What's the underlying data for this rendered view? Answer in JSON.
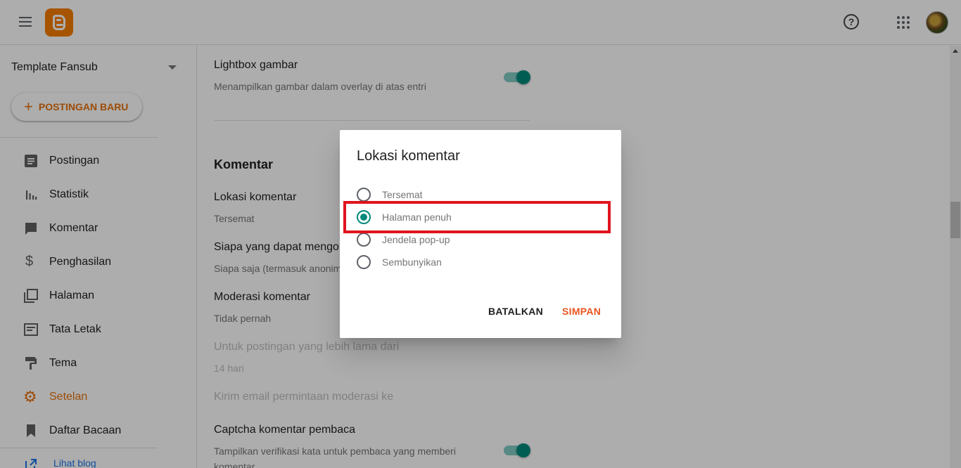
{
  "colors": {
    "accent": "#e8710a",
    "teal": "#00897b",
    "highlight": "#e0141e"
  },
  "header": {
    "menu_icon": "menu-icon",
    "logo": "blogger-logo",
    "help_icon": "help-icon",
    "help_glyph": "?",
    "apps_icon": "apps-grid-icon",
    "avatar": "user-avatar"
  },
  "sidebar": {
    "blog_name": "Template Fansub",
    "new_post_plus": "+",
    "new_post_label": "POSTINGAN BARU",
    "items": [
      {
        "label": "Postingan",
        "icon": "posts-icon"
      },
      {
        "label": "Statistik",
        "icon": "stats-icon"
      },
      {
        "label": "Komentar",
        "icon": "comment-icon"
      },
      {
        "label": "Penghasilan",
        "icon": "dollar-icon",
        "glyph": "$"
      },
      {
        "label": "Halaman",
        "icon": "pages-icon"
      },
      {
        "label": "Tata Letak",
        "icon": "layout-icon"
      },
      {
        "label": "Tema",
        "icon": "theme-icon"
      },
      {
        "label": "Setelan",
        "icon": "gear-icon",
        "glyph": "⚙"
      },
      {
        "label": "Daftar Bacaan",
        "icon": "bookmark-icon"
      }
    ],
    "view_blog": "Lihat blog"
  },
  "main": {
    "lightbox_title": "Lightbox gambar",
    "lightbox_sub": "Menampilkan gambar dalam overlay di atas entri",
    "section_comments": "Komentar",
    "location_title": "Lokasi komentar",
    "location_value": "Tersemat",
    "who_title": "Siapa yang dapat mengom",
    "who_value": "Siapa saja (termasuk anonim",
    "moderation_title": "Moderasi komentar",
    "moderation_value": "Tidak pernah",
    "older_title": "Untuk postingan yang lebih lama dari",
    "older_value": "14 hari",
    "email_title": "Kirim email permintaan moderasi ke",
    "captcha_title": "Captcha komentar pembaca",
    "captcha_sub": "Tampilkan verifikasi kata untuk pembaca yang memberi",
    "captcha_sub2": "komentar"
  },
  "dialog": {
    "title": "Lokasi komentar",
    "options": [
      {
        "label": "Tersemat",
        "checked": false
      },
      {
        "label": "Halaman penuh",
        "checked": true
      },
      {
        "label": "Jendela pop-up",
        "checked": false
      },
      {
        "label": "Sembunyikan",
        "checked": false
      }
    ],
    "cancel": "BATALKAN",
    "save": "SIMPAN"
  }
}
